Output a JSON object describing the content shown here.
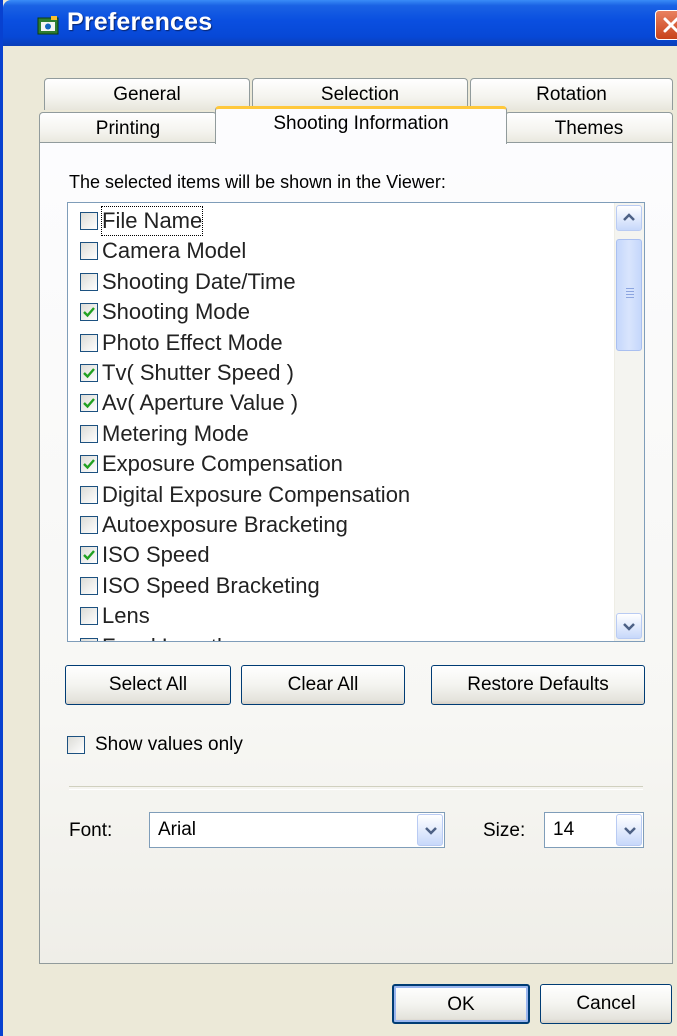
{
  "window": {
    "title": "Preferences"
  },
  "tabs": {
    "row_back": [
      "General",
      "Selection",
      "Rotation"
    ],
    "row_front": [
      "Printing",
      "Shooting Information",
      "Themes"
    ],
    "active": "Shooting Information"
  },
  "instruction": "The selected items will be shown in the Viewer:",
  "items": [
    {
      "label": "File Name",
      "checked": false
    },
    {
      "label": "Camera Model",
      "checked": false
    },
    {
      "label": "Shooting Date/Time",
      "checked": false
    },
    {
      "label": "Shooting Mode",
      "checked": true
    },
    {
      "label": "Photo Effect Mode",
      "checked": false
    },
    {
      "label": "Tv( Shutter Speed )",
      "checked": true
    },
    {
      "label": "Av( Aperture Value )",
      "checked": true
    },
    {
      "label": "Metering Mode",
      "checked": false
    },
    {
      "label": "Exposure Compensation",
      "checked": true
    },
    {
      "label": "Digital Exposure Compensation",
      "checked": false
    },
    {
      "label": "Autoexposure Bracketing",
      "checked": false
    },
    {
      "label": "ISO Speed",
      "checked": true
    },
    {
      "label": "ISO Speed Bracketing",
      "checked": false
    },
    {
      "label": "Lens",
      "checked": false
    },
    {
      "label": "Focal Length",
      "checked": true
    }
  ],
  "buttons": {
    "select_all": "Select All",
    "clear_all": "Clear All",
    "restore_defaults": "Restore Defaults",
    "ok": "OK",
    "cancel": "Cancel"
  },
  "show_values_only": {
    "label": "Show values only",
    "checked": false
  },
  "font": {
    "label": "Font:",
    "value": "Arial"
  },
  "size": {
    "label": "Size:",
    "value": "14"
  },
  "colors": {
    "titlebar": "#0a4fe0",
    "active_tab_accent": "#ffc83c",
    "check": "#21a121"
  }
}
